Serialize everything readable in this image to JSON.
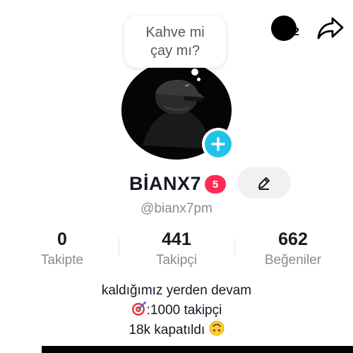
{
  "header": {
    "account_switch_count": "2",
    "account_icon": "account-avatar-icon",
    "share_icon": "share-arrow-icon"
  },
  "bubble": {
    "line1": "Kahve mi",
    "line2": "çay mı?"
  },
  "profile": {
    "username": "BİANX7",
    "badge": "5",
    "handle": "@bianx7pm",
    "edit_icon": "pencil-icon",
    "add_icon": "plus-icon"
  },
  "stats": [
    {
      "value": "0",
      "label": "Takipte"
    },
    {
      "value": "441",
      "label": "Takipçi"
    },
    {
      "value": "662",
      "label": "Beğeniler"
    }
  ],
  "bio": {
    "line1": "kaldığımız yerden devam",
    "line2_text": ":1000 takipçi",
    "line2_icon": "target-icon",
    "line3_text": "18k kapatıldı ",
    "line3_icon": "upside-down-face-icon"
  },
  "colors": {
    "accent_plus": "#20c4e8",
    "badge": "#fe2c55",
    "muted_text": "#8a8b91"
  }
}
